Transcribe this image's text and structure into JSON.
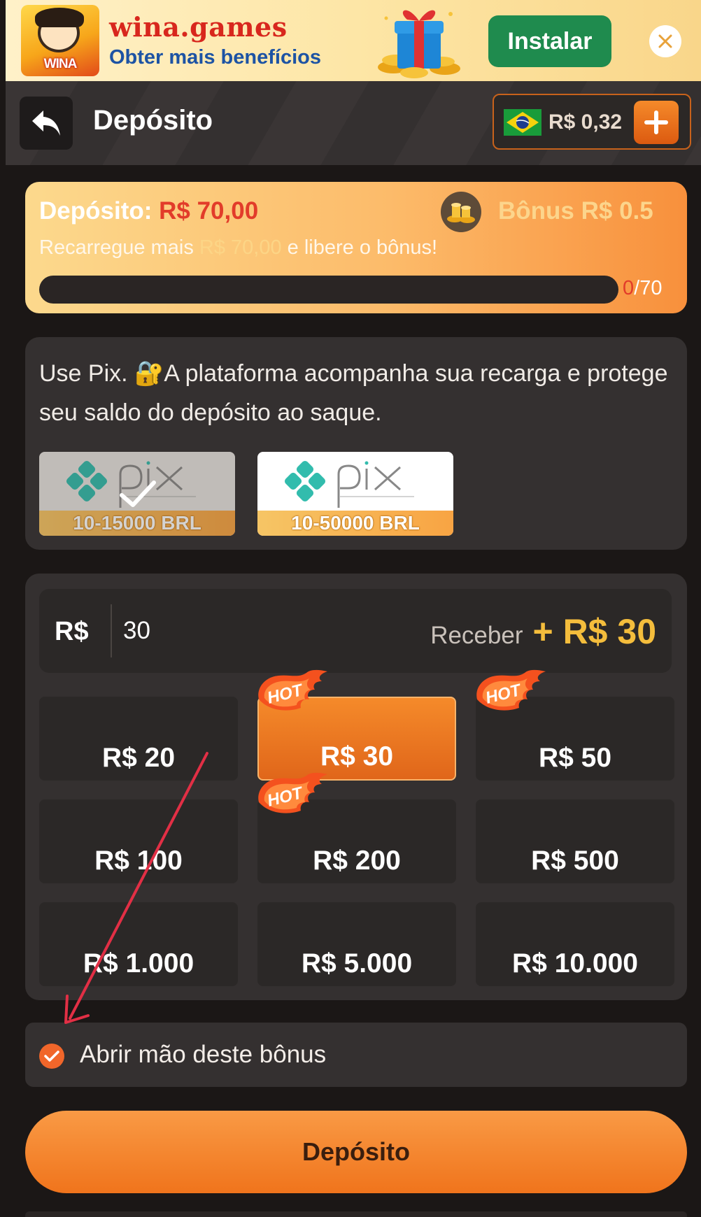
{
  "banner": {
    "logo_text": "WINA",
    "title": "wina.games",
    "subtitle": "Obter mais benefícios",
    "install_label": "Instalar"
  },
  "header": {
    "title": "Depósito",
    "balance": "R$ 0,32"
  },
  "bonus_card": {
    "deposit_label": "Depósito:",
    "deposit_amount": "R$ 70,00",
    "bonus_label": "Bônus R$ 0.5",
    "desc_prefix": "Recarregue mais",
    "desc_amount": "R$ 70,00",
    "desc_suffix": "e libere o bônus!",
    "progress_current": "0",
    "progress_total": "/70",
    "progress_fraction": 0
  },
  "method": {
    "description": "Use Pix. 🔐A plataforma acompanha sua recarga e protege seu saldo do depósito ao saque.",
    "options": [
      {
        "brand": "pix",
        "range": "10-15000 BRL",
        "selected": true
      },
      {
        "brand": "pix",
        "range": "10-50000 BRL",
        "selected": false
      }
    ]
  },
  "amount": {
    "currency": "R$",
    "value": "30",
    "receive_label": "Receber",
    "receive_bonus": "+ R$ 30",
    "hot_label": "HOT",
    "chips": [
      {
        "label": "R$ 20",
        "hot": false,
        "active": false
      },
      {
        "label": "R$ 30",
        "hot": true,
        "active": true
      },
      {
        "label": "R$ 50",
        "hot": true,
        "active": false
      },
      {
        "label": "R$ 100",
        "hot": false,
        "active": false
      },
      {
        "label": "R$ 200",
        "hot": true,
        "active": false
      },
      {
        "label": "R$ 500",
        "hot": false,
        "active": false
      },
      {
        "label": "R$ 1.000",
        "hot": false,
        "active": false
      },
      {
        "label": "R$ 5.000",
        "hot": false,
        "active": false
      },
      {
        "label": "R$ 10.000",
        "hot": false,
        "active": false
      }
    ]
  },
  "optout": {
    "label": "Abrir mão deste bônus",
    "checked": true
  },
  "deposit_button": "Depósito",
  "colors": {
    "accent": "#f0741c",
    "bonus_gold": "#f4bd3c",
    "alert_red": "#e23c2a",
    "install_green": "#1f8b4e"
  },
  "icons": {
    "back": "back-arrow-icon",
    "close": "close-icon",
    "add": "plus-icon",
    "flag": "brazil-flag-icon",
    "coins": "gold-coins-icon",
    "check": "check-icon",
    "hot": "hot-flame-icon"
  }
}
